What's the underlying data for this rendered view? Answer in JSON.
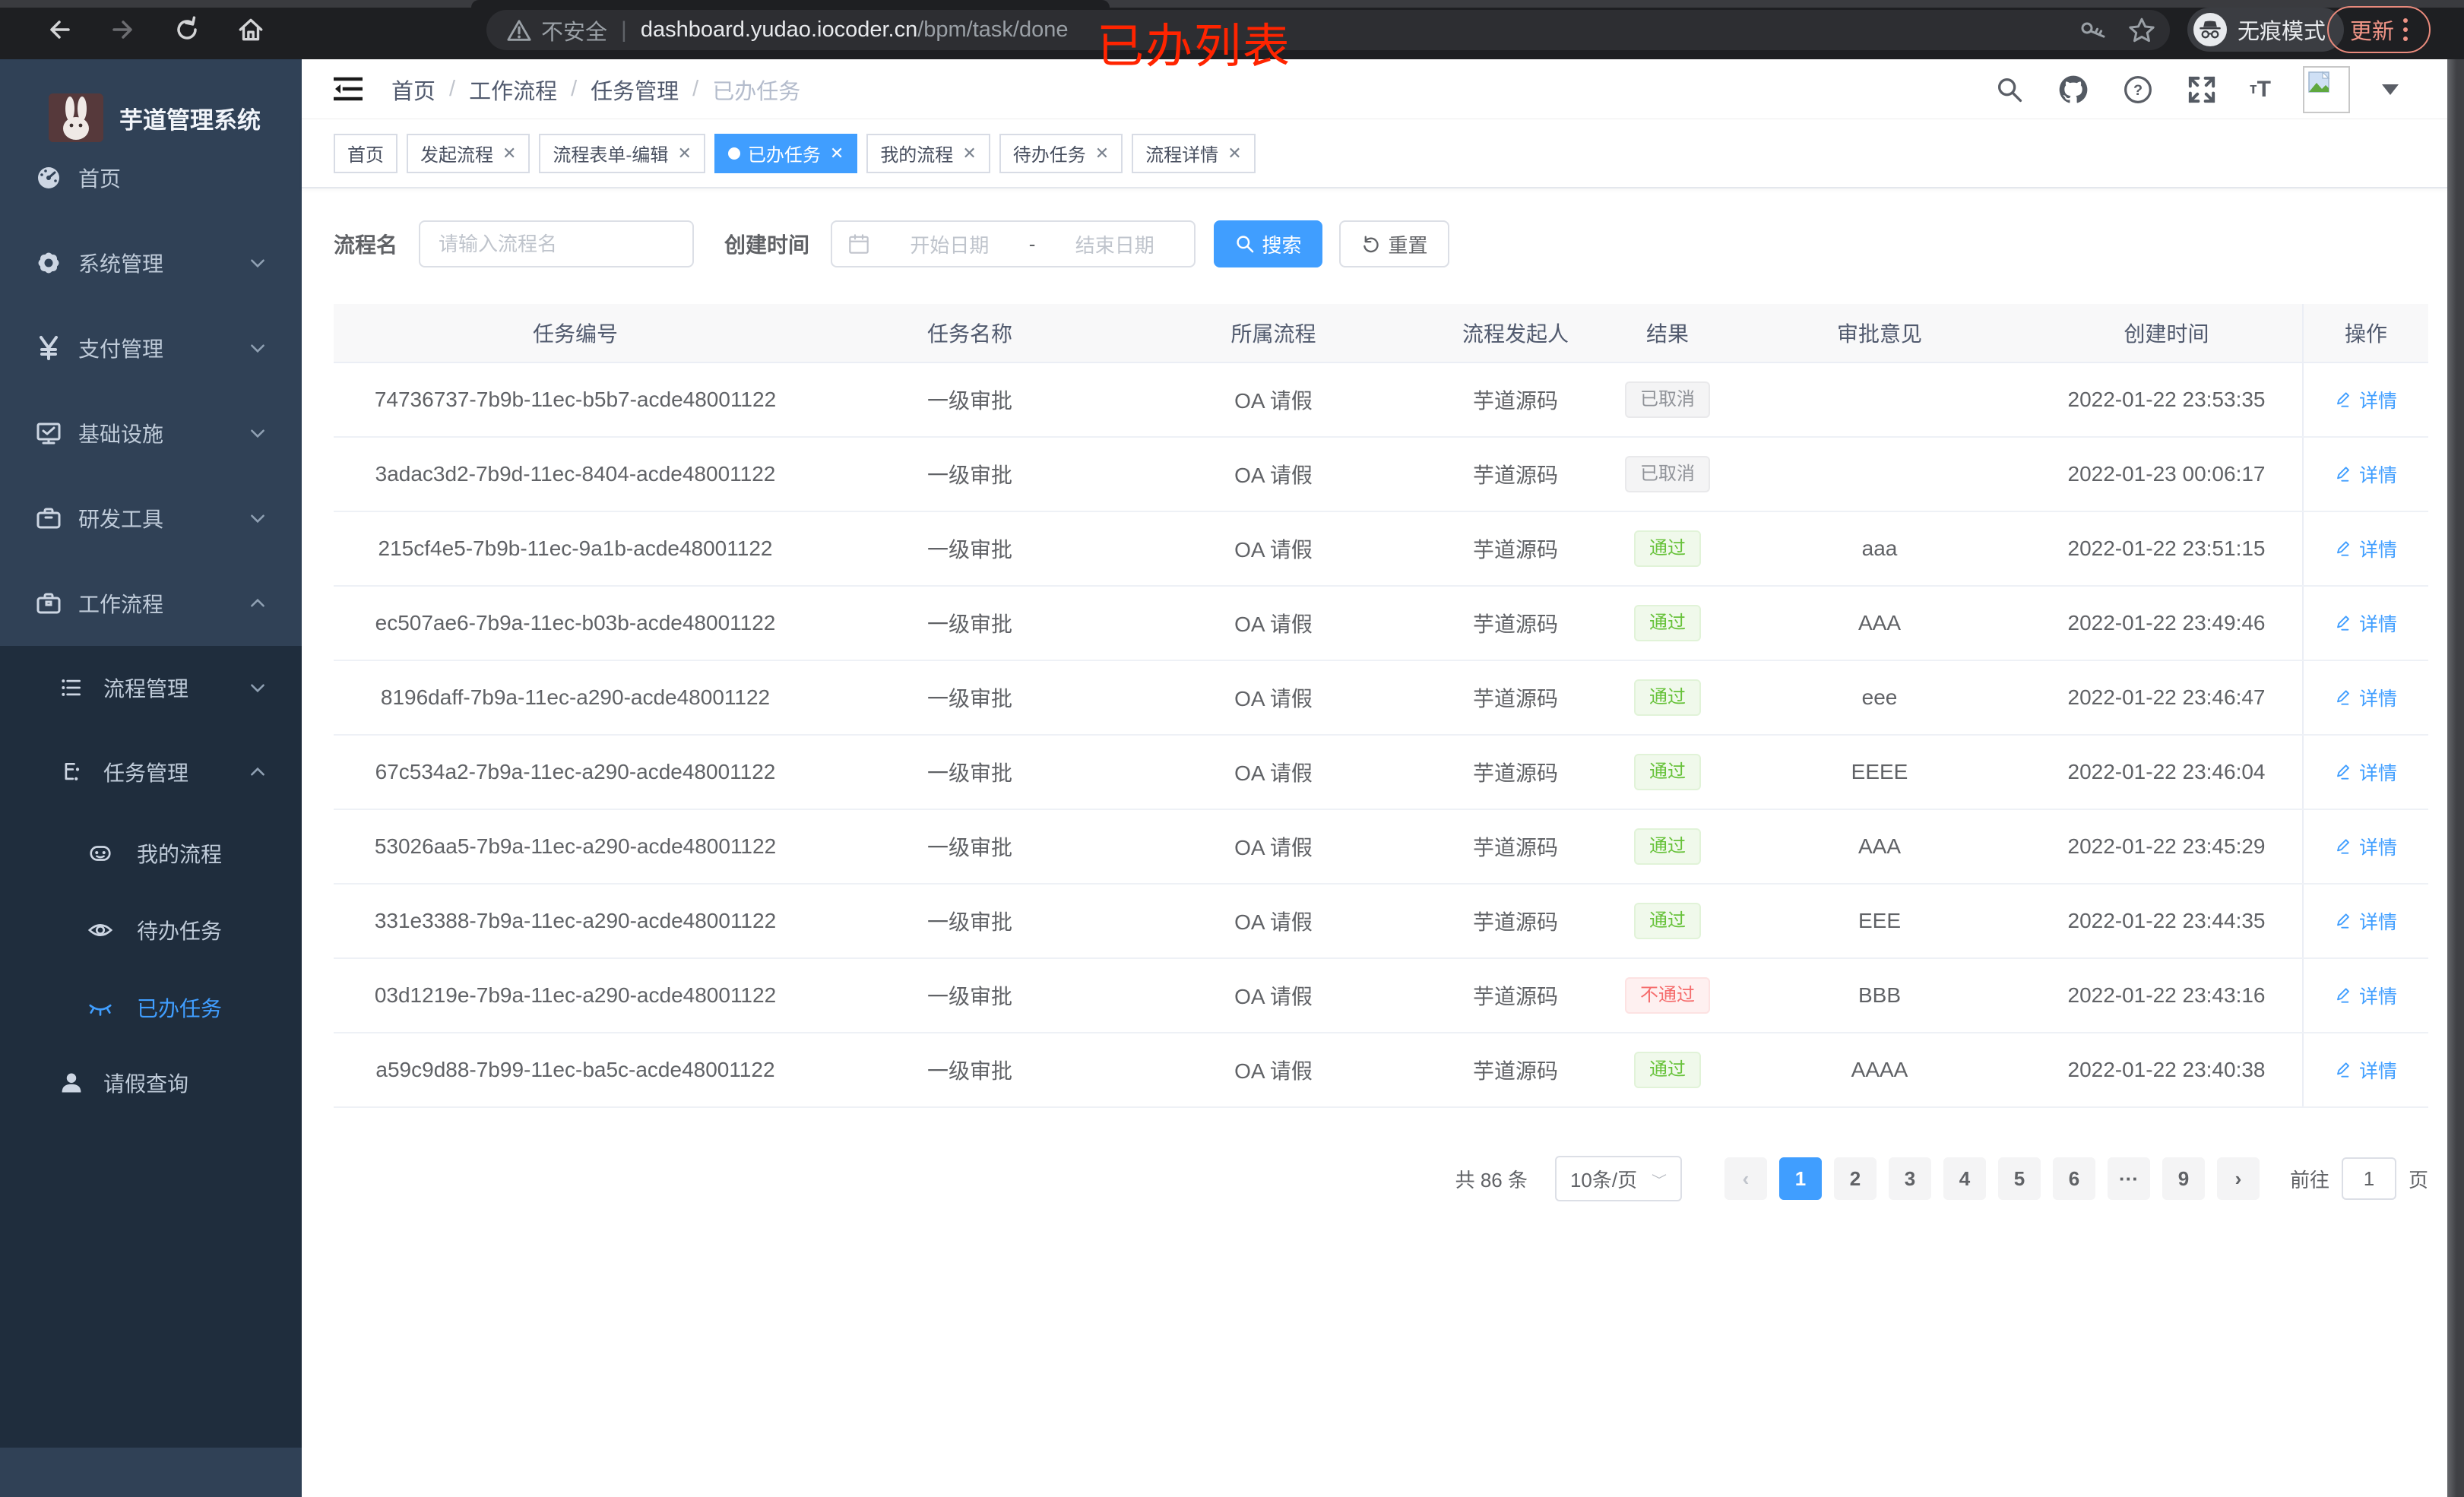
{
  "browser": {
    "security_label": "不安全",
    "url_host": "dashboard.yudao.iocoder.cn",
    "url_path": "/bpm/task/done",
    "incognito_label": "无痕模式",
    "update_label": "更新"
  },
  "annotation": "已办列表",
  "colors": {
    "accent": "#409eff",
    "pass": "#67c23a",
    "fail": "#f56c6c",
    "cancel": "#909399",
    "sidebar_bg": "#304156",
    "submenu_bg": "#1f2d3d"
  },
  "sidebar": {
    "title": "芋道管理系统",
    "items": [
      {
        "label": "首页",
        "icon": "dashboard-icon"
      },
      {
        "label": "系统管理",
        "icon": "gear-icon",
        "expand": "down"
      },
      {
        "label": "支付管理",
        "icon": "yen-icon",
        "expand": "down"
      },
      {
        "label": "基础设施",
        "icon": "monitor-icon",
        "expand": "down"
      },
      {
        "label": "研发工具",
        "icon": "toolbox-icon",
        "expand": "down"
      },
      {
        "label": "工作流程",
        "icon": "briefcase-icon",
        "expand": "up"
      },
      {
        "label": "流程管理",
        "icon": "tree-icon",
        "expand": "down"
      },
      {
        "label": "任务管理",
        "icon": "org-icon",
        "expand": "up"
      },
      {
        "label": "我的流程",
        "icon": "robot-icon"
      },
      {
        "label": "待办任务",
        "icon": "eye-icon"
      },
      {
        "label": "已办任务",
        "icon": "eye-closed-icon",
        "active": true
      },
      {
        "label": "请假查询",
        "icon": "user-icon"
      }
    ]
  },
  "header": {
    "breadcrumb": [
      "首页",
      "工作流程",
      "任务管理",
      "已办任务"
    ]
  },
  "tabs": [
    {
      "label": "首页"
    },
    {
      "label": "发起流程",
      "closable": true
    },
    {
      "label": "流程表单-编辑",
      "closable": true
    },
    {
      "label": "已办任务",
      "closable": true,
      "active": true
    },
    {
      "label": "我的流程",
      "closable": true
    },
    {
      "label": "待办任务",
      "closable": true
    },
    {
      "label": "流程详情",
      "closable": true
    }
  ],
  "filters": {
    "name_label": "流程名",
    "name_placeholder": "请输入流程名",
    "time_label": "创建时间",
    "start_placeholder": "开始日期",
    "range_separator": "-",
    "end_placeholder": "结束日期",
    "search_label": "搜索",
    "reset_label": "重置"
  },
  "table": {
    "columns": [
      "任务编号",
      "任务名称",
      "所属流程",
      "流程发起人",
      "结果",
      "审批意见",
      "创建时间",
      "操作"
    ],
    "action_label": "详情",
    "rows": [
      {
        "id": "74736737-7b9b-11ec-b5b7-acde48001122",
        "name": "一级审批",
        "process": "OA 请假",
        "starter": "芋道源码",
        "result": "已取消",
        "result_type": "cancel",
        "comment": "",
        "time": "2022-01-22 23:53:35"
      },
      {
        "id": "3adac3d2-7b9d-11ec-8404-acde48001122",
        "name": "一级审批",
        "process": "OA 请假",
        "starter": "芋道源码",
        "result": "已取消",
        "result_type": "cancel",
        "comment": "",
        "time": "2022-01-23 00:06:17"
      },
      {
        "id": "215cf4e5-7b9b-11ec-9a1b-acde48001122",
        "name": "一级审批",
        "process": "OA 请假",
        "starter": "芋道源码",
        "result": "通过",
        "result_type": "pass",
        "comment": "aaa",
        "time": "2022-01-22 23:51:15"
      },
      {
        "id": "ec507ae6-7b9a-11ec-b03b-acde48001122",
        "name": "一级审批",
        "process": "OA 请假",
        "starter": "芋道源码",
        "result": "通过",
        "result_type": "pass",
        "comment": "AAA",
        "time": "2022-01-22 23:49:46"
      },
      {
        "id": "8196daff-7b9a-11ec-a290-acde48001122",
        "name": "一级审批",
        "process": "OA 请假",
        "starter": "芋道源码",
        "result": "通过",
        "result_type": "pass",
        "comment": "eee",
        "time": "2022-01-22 23:46:47"
      },
      {
        "id": "67c534a2-7b9a-11ec-a290-acde48001122",
        "name": "一级审批",
        "process": "OA 请假",
        "starter": "芋道源码",
        "result": "通过",
        "result_type": "pass",
        "comment": "EEEE",
        "time": "2022-01-22 23:46:04"
      },
      {
        "id": "53026aa5-7b9a-11ec-a290-acde48001122",
        "name": "一级审批",
        "process": "OA 请假",
        "starter": "芋道源码",
        "result": "通过",
        "result_type": "pass",
        "comment": "AAA",
        "time": "2022-01-22 23:45:29"
      },
      {
        "id": "331e3388-7b9a-11ec-a290-acde48001122",
        "name": "一级审批",
        "process": "OA 请假",
        "starter": "芋道源码",
        "result": "通过",
        "result_type": "pass",
        "comment": "EEE",
        "time": "2022-01-22 23:44:35"
      },
      {
        "id": "03d1219e-7b9a-11ec-a290-acde48001122",
        "name": "一级审批",
        "process": "OA 请假",
        "starter": "芋道源码",
        "result": "不通过",
        "result_type": "fail",
        "comment": "BBB",
        "time": "2022-01-22 23:43:16"
      },
      {
        "id": "a59c9d88-7b99-11ec-ba5c-acde48001122",
        "name": "一级审批",
        "process": "OA 请假",
        "starter": "芋道源码",
        "result": "通过",
        "result_type": "pass",
        "comment": "AAAA",
        "time": "2022-01-22 23:40:38"
      }
    ]
  },
  "pagination": {
    "total": "共 86 条",
    "page_size": "10条/页",
    "prev": "‹",
    "next": "›",
    "pages": [
      "1",
      "2",
      "3",
      "4",
      "5",
      "6",
      "···",
      "9"
    ],
    "active": "1",
    "goto": "前往",
    "goto_value": "1",
    "page_suffix": "页"
  }
}
